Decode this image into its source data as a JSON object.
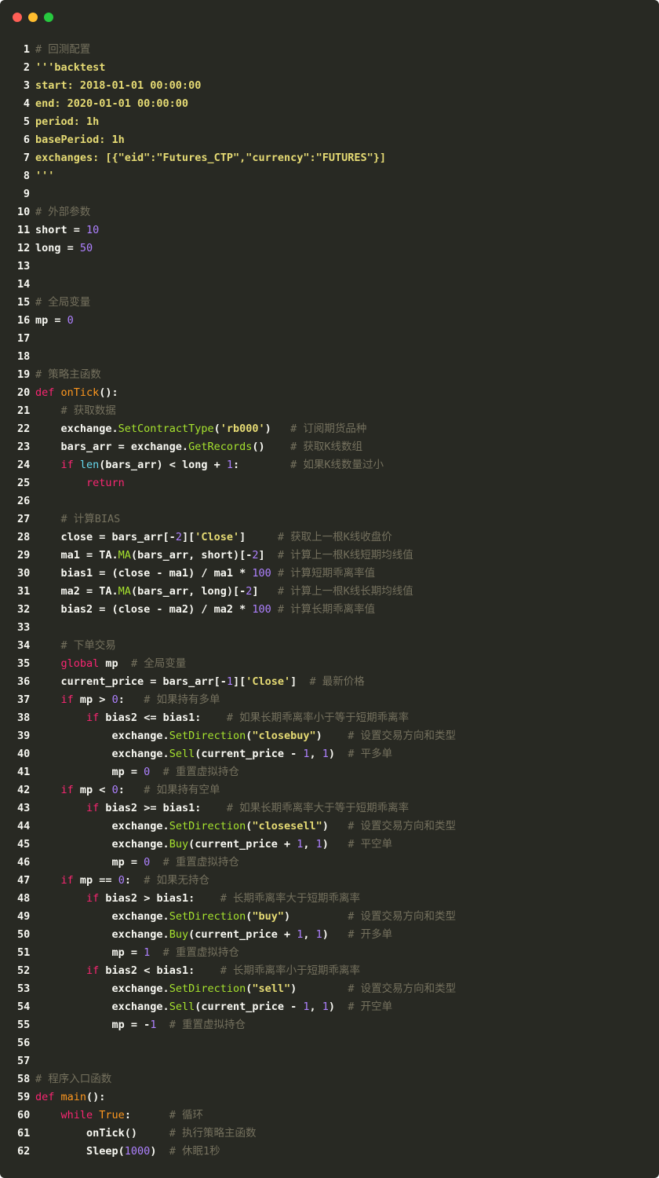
{
  "window": {
    "controls": [
      {
        "name": "close",
        "color": "#ff5f56"
      },
      {
        "name": "minimize",
        "color": "#ffbd2e"
      },
      {
        "name": "maximize",
        "color": "#27c93f"
      }
    ]
  },
  "colors": {
    "background": "#282923",
    "keyword": "#f92672",
    "function": "#a6e22e",
    "builtin": "#66d9ef",
    "string": "#e6db74",
    "number": "#ae81ff",
    "comment": "#75715e",
    "defname": "#fd971f",
    "plain": "#f8f8f2"
  },
  "code_lines": [
    [
      [
        "c",
        "# 回测配置"
      ]
    ],
    [
      [
        "y",
        "'''backtest"
      ]
    ],
    [
      [
        "y",
        "start: 2018-01-01 00:00:00"
      ]
    ],
    [
      [
        "y",
        "end: 2020-01-01 00:00:00"
      ]
    ],
    [
      [
        "y",
        "period: 1h"
      ]
    ],
    [
      [
        "y",
        "basePeriod: 1h"
      ]
    ],
    [
      [
        "y",
        "exchanges: [{\"eid\":\"Futures_CTP\",\"currency\":\"FUTURES\"}]"
      ]
    ],
    [
      [
        "y",
        "'''"
      ]
    ],
    [],
    [
      [
        "c",
        "# 外部参数"
      ]
    ],
    [
      [
        "p",
        "short = "
      ],
      [
        "n",
        "10"
      ]
    ],
    [
      [
        "p",
        "long = "
      ],
      [
        "n",
        "50"
      ]
    ],
    [],
    [],
    [
      [
        "c",
        "# 全局变量"
      ]
    ],
    [
      [
        "p",
        "mp = "
      ],
      [
        "n",
        "0"
      ]
    ],
    [],
    [],
    [
      [
        "c",
        "# 策略主函数"
      ]
    ],
    [
      [
        "k",
        "def "
      ],
      [
        "d",
        "onTick"
      ],
      [
        "p",
        "():"
      ]
    ],
    [
      [
        "p",
        "    "
      ],
      [
        "c",
        "# 获取数据"
      ]
    ],
    [
      [
        "p",
        "    exchange."
      ],
      [
        "f",
        "SetContractType"
      ],
      [
        "p",
        "("
      ],
      [
        "s",
        "'rb000'"
      ],
      [
        "p",
        ")   "
      ],
      [
        "c",
        "# 订阅期货品种"
      ]
    ],
    [
      [
        "p",
        "    bars_arr = exchange."
      ],
      [
        "f",
        "GetRecords"
      ],
      [
        "p",
        "()    "
      ],
      [
        "c",
        "# 获取K线数组"
      ]
    ],
    [
      [
        "p",
        "    "
      ],
      [
        "k",
        "if "
      ],
      [
        "b",
        "len"
      ],
      [
        "p",
        "(bars_arr) < long + "
      ],
      [
        "n",
        "1"
      ],
      [
        "p",
        ":        "
      ],
      [
        "c",
        "# 如果K线数量过小"
      ]
    ],
    [
      [
        "p",
        "        "
      ],
      [
        "k",
        "return"
      ]
    ],
    [],
    [
      [
        "p",
        "    "
      ],
      [
        "c",
        "# 计算BIAS"
      ]
    ],
    [
      [
        "p",
        "    close = bars_arr[-"
      ],
      [
        "n",
        "2"
      ],
      [
        "p",
        "]["
      ],
      [
        "s",
        "'Close'"
      ],
      [
        "p",
        "]     "
      ],
      [
        "c",
        "# 获取上一根K线收盘价"
      ]
    ],
    [
      [
        "p",
        "    ma1 = TA."
      ],
      [
        "f",
        "MA"
      ],
      [
        "p",
        "(bars_arr, short)[-"
      ],
      [
        "n",
        "2"
      ],
      [
        "p",
        "]  "
      ],
      [
        "c",
        "# 计算上一根K线短期均线值"
      ]
    ],
    [
      [
        "p",
        "    bias1 = (close - ma1) / ma1 * "
      ],
      [
        "n",
        "100"
      ],
      [
        "p",
        " "
      ],
      [
        "c",
        "# 计算短期乖离率值"
      ]
    ],
    [
      [
        "p",
        "    ma2 = TA."
      ],
      [
        "f",
        "MA"
      ],
      [
        "p",
        "(bars_arr, long)[-"
      ],
      [
        "n",
        "2"
      ],
      [
        "p",
        "]   "
      ],
      [
        "c",
        "# 计算上一根K线长期均线值"
      ]
    ],
    [
      [
        "p",
        "    bias2 = (close - ma2) / ma2 * "
      ],
      [
        "n",
        "100"
      ],
      [
        "p",
        " "
      ],
      [
        "c",
        "# 计算长期乖离率值"
      ]
    ],
    [],
    [
      [
        "p",
        "    "
      ],
      [
        "c",
        "# 下单交易"
      ]
    ],
    [
      [
        "p",
        "    "
      ],
      [
        "k",
        "global"
      ],
      [
        "p",
        " mp  "
      ],
      [
        "c",
        "# 全局变量"
      ]
    ],
    [
      [
        "p",
        "    current_price = bars_arr[-"
      ],
      [
        "n",
        "1"
      ],
      [
        "p",
        "]["
      ],
      [
        "s",
        "'Close'"
      ],
      [
        "p",
        "]  "
      ],
      [
        "c",
        "# 最新价格"
      ]
    ],
    [
      [
        "p",
        "    "
      ],
      [
        "k",
        "if"
      ],
      [
        "p",
        " mp > "
      ],
      [
        "n",
        "0"
      ],
      [
        "p",
        ":   "
      ],
      [
        "c",
        "# 如果持有多单"
      ]
    ],
    [
      [
        "p",
        "        "
      ],
      [
        "k",
        "if"
      ],
      [
        "p",
        " bias2 <= bias1:    "
      ],
      [
        "c",
        "# 如果长期乖离率小于等于短期乖离率"
      ]
    ],
    [
      [
        "p",
        "            exchange."
      ],
      [
        "f",
        "SetDirection"
      ],
      [
        "p",
        "("
      ],
      [
        "s",
        "\"closebuy\""
      ],
      [
        "p",
        ")    "
      ],
      [
        "c",
        "# 设置交易方向和类型"
      ]
    ],
    [
      [
        "p",
        "            exchange."
      ],
      [
        "f",
        "Sell"
      ],
      [
        "p",
        "(current_price - "
      ],
      [
        "n",
        "1"
      ],
      [
        "p",
        ", "
      ],
      [
        "n",
        "1"
      ],
      [
        "p",
        ")  "
      ],
      [
        "c",
        "# 平多单"
      ]
    ],
    [
      [
        "p",
        "            mp = "
      ],
      [
        "n",
        "0"
      ],
      [
        "p",
        "  "
      ],
      [
        "c",
        "# 重置虚拟持仓"
      ]
    ],
    [
      [
        "p",
        "    "
      ],
      [
        "k",
        "if"
      ],
      [
        "p",
        " mp < "
      ],
      [
        "n",
        "0"
      ],
      [
        "p",
        ":   "
      ],
      [
        "c",
        "# 如果持有空单"
      ]
    ],
    [
      [
        "p",
        "        "
      ],
      [
        "k",
        "if"
      ],
      [
        "p",
        " bias2 >= bias1:    "
      ],
      [
        "c",
        "# 如果长期乖离率大于等于短期乖离率"
      ]
    ],
    [
      [
        "p",
        "            exchange."
      ],
      [
        "f",
        "SetDirection"
      ],
      [
        "p",
        "("
      ],
      [
        "s",
        "\"closesell\""
      ],
      [
        "p",
        ")   "
      ],
      [
        "c",
        "# 设置交易方向和类型"
      ]
    ],
    [
      [
        "p",
        "            exchange."
      ],
      [
        "f",
        "Buy"
      ],
      [
        "p",
        "(current_price + "
      ],
      [
        "n",
        "1"
      ],
      [
        "p",
        ", "
      ],
      [
        "n",
        "1"
      ],
      [
        "p",
        ")   "
      ],
      [
        "c",
        "# 平空单"
      ]
    ],
    [
      [
        "p",
        "            mp = "
      ],
      [
        "n",
        "0"
      ],
      [
        "p",
        "  "
      ],
      [
        "c",
        "# 重置虚拟持仓"
      ]
    ],
    [
      [
        "p",
        "    "
      ],
      [
        "k",
        "if"
      ],
      [
        "p",
        " mp == "
      ],
      [
        "n",
        "0"
      ],
      [
        "p",
        ":  "
      ],
      [
        "c",
        "# 如果无持仓"
      ]
    ],
    [
      [
        "p",
        "        "
      ],
      [
        "k",
        "if"
      ],
      [
        "p",
        " bias2 > bias1:    "
      ],
      [
        "c",
        "# 长期乖离率大于短期乖离率"
      ]
    ],
    [
      [
        "p",
        "            exchange."
      ],
      [
        "f",
        "SetDirection"
      ],
      [
        "p",
        "("
      ],
      [
        "s",
        "\"buy\""
      ],
      [
        "p",
        ")         "
      ],
      [
        "c",
        "# 设置交易方向和类型"
      ]
    ],
    [
      [
        "p",
        "            exchange."
      ],
      [
        "f",
        "Buy"
      ],
      [
        "p",
        "(current_price + "
      ],
      [
        "n",
        "1"
      ],
      [
        "p",
        ", "
      ],
      [
        "n",
        "1"
      ],
      [
        "p",
        ")   "
      ],
      [
        "c",
        "# 开多单"
      ]
    ],
    [
      [
        "p",
        "            mp = "
      ],
      [
        "n",
        "1"
      ],
      [
        "p",
        "  "
      ],
      [
        "c",
        "# 重置虚拟持仓"
      ]
    ],
    [
      [
        "p",
        "        "
      ],
      [
        "k",
        "if"
      ],
      [
        "p",
        " bias2 < bias1:    "
      ],
      [
        "c",
        "# 长期乖离率小于短期乖离率"
      ]
    ],
    [
      [
        "p",
        "            exchange."
      ],
      [
        "f",
        "SetDirection"
      ],
      [
        "p",
        "("
      ],
      [
        "s",
        "\"sell\""
      ],
      [
        "p",
        ")        "
      ],
      [
        "c",
        "# 设置交易方向和类型"
      ]
    ],
    [
      [
        "p",
        "            exchange."
      ],
      [
        "f",
        "Sell"
      ],
      [
        "p",
        "(current_price - "
      ],
      [
        "n",
        "1"
      ],
      [
        "p",
        ", "
      ],
      [
        "n",
        "1"
      ],
      [
        "p",
        ")  "
      ],
      [
        "c",
        "# 开空单"
      ]
    ],
    [
      [
        "p",
        "            mp = -"
      ],
      [
        "n",
        "1"
      ],
      [
        "p",
        "  "
      ],
      [
        "c",
        "# 重置虚拟持仓"
      ]
    ],
    [],
    [],
    [
      [
        "c",
        "# 程序入口函数"
      ]
    ],
    [
      [
        "k",
        "def "
      ],
      [
        "d",
        "main"
      ],
      [
        "p",
        "():"
      ]
    ],
    [
      [
        "p",
        "    "
      ],
      [
        "k",
        "while "
      ],
      [
        "d",
        "True"
      ],
      [
        "p",
        ":      "
      ],
      [
        "c",
        "# 循环"
      ]
    ],
    [
      [
        "p",
        "        onTick()     "
      ],
      [
        "c",
        "# 执行策略主函数"
      ]
    ],
    [
      [
        "p",
        "        Sleep("
      ],
      [
        "n",
        "1000"
      ],
      [
        "p",
        ")  "
      ],
      [
        "c",
        "# 休眠1秒"
      ]
    ]
  ]
}
